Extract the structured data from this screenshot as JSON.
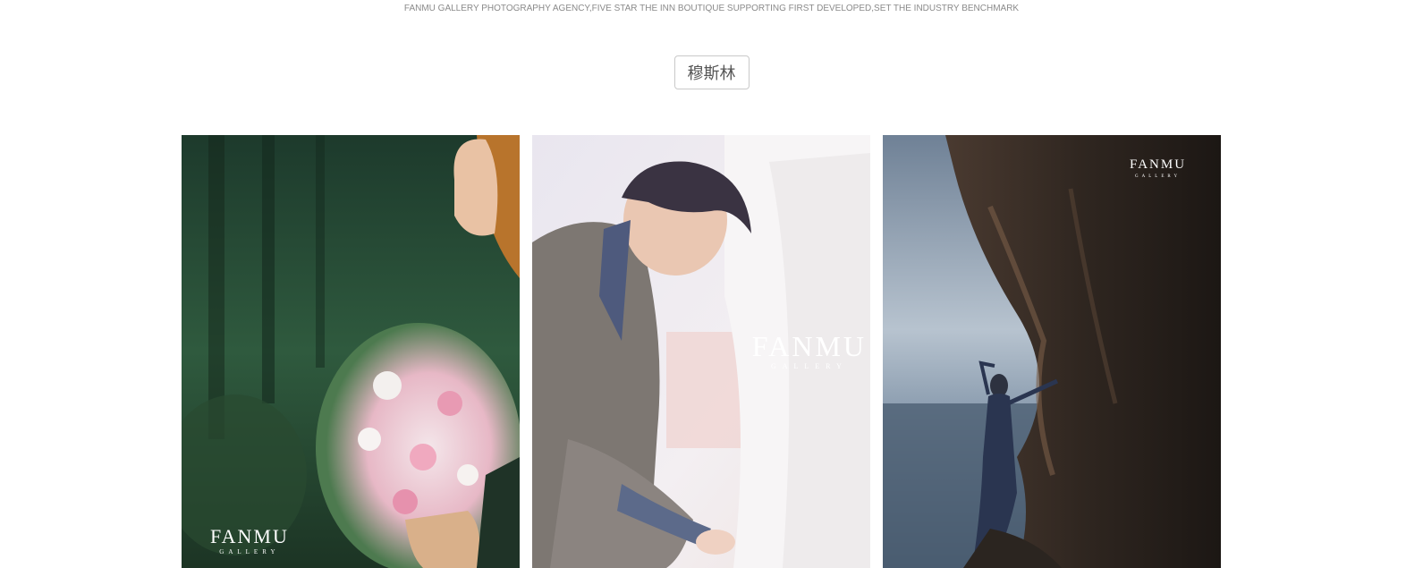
{
  "header": {
    "tagline": "FANMU GALLERY PHOTOGRAPHY AGENCY,FIVE STAR THE INN BOUTIQUE SUPPORTING FIRST DEVELOPED,SET THE INDUSTRY BENCHMARK"
  },
  "category": {
    "label": "穆斯林"
  },
  "gallery": {
    "photos": [
      {
        "subject": "bride-with-flower-bouquet-photo",
        "watermark_brand": "FANMU",
        "watermark_sub": "GALLERY"
      },
      {
        "subject": "groom-kneeling-photo",
        "watermark_brand": "FANMU",
        "watermark_sub": "GALLERY"
      },
      {
        "subject": "bride-on-sea-cliff-photo",
        "watermark_brand": "FANMU",
        "watermark_sub": "GALLERY"
      }
    ]
  },
  "colors": {
    "tagline_text": "#8a8a8a",
    "tag_border": "#c9c9c9",
    "tag_text": "#555555",
    "background": "#ffffff"
  }
}
